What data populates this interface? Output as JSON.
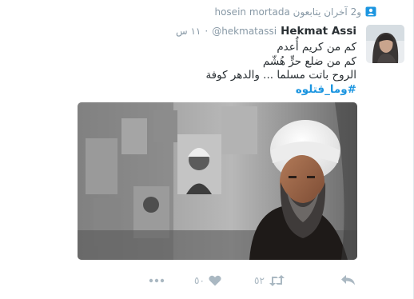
{
  "context": {
    "names": "hosein mortada",
    "rest": "و2 آخران يتابعون"
  },
  "tweet": {
    "fullname": "Hekmat Assi",
    "handle": "@hekmatassi",
    "separator": "·",
    "time": "١١ س",
    "lines": [
      "كم من كريم أُعدم",
      "كم من ضلع حرٍّ هُشّم",
      "الروح باتت مسلما ... والدهر كوفة"
    ],
    "hashtag": "#وما_قتلوه"
  },
  "actions": {
    "retweet_count": "٥٢",
    "like_count": "٥٠"
  },
  "colors": {
    "accent": "#1b95e0",
    "muted": "#8899a6",
    "icon": "#aab8c2"
  },
  "icons": [
    "person-follow-icon",
    "reply-icon",
    "retweet-icon",
    "heart-icon",
    "more-icon"
  ]
}
